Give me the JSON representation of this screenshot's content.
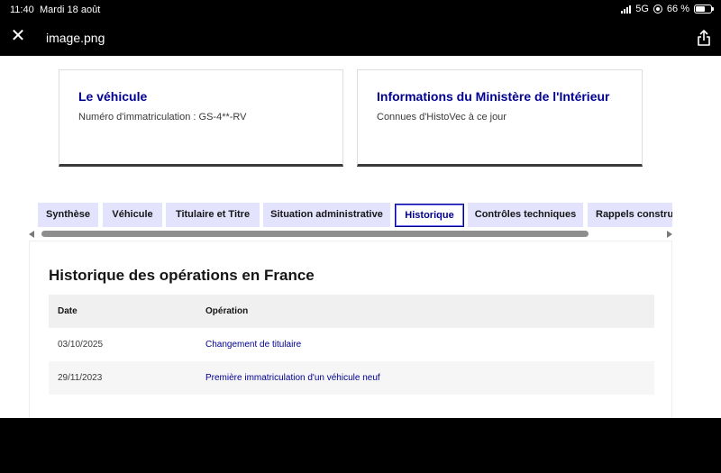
{
  "status": {
    "time": "11:40",
    "date": "Mardi 18 août",
    "network": "5G",
    "battery": "66 %"
  },
  "topbar": {
    "filename": "image.png"
  },
  "cards": [
    {
      "title": "Le véhicule",
      "subtitle": "Numéro d'immatriculation : GS-4**-RV"
    },
    {
      "title": "Informations du Ministère de l'Intérieur",
      "subtitle": "Connues d'HistoVec à ce jour"
    }
  ],
  "tabs": [
    {
      "label": "Synthèse"
    },
    {
      "label": "Véhicule"
    },
    {
      "label": "Titulaire et Titre"
    },
    {
      "label": "Situation administrative"
    },
    {
      "label": "Historique",
      "active": true
    },
    {
      "label": "Contrôles techniques"
    },
    {
      "label": "Rappels construc"
    }
  ],
  "section": {
    "title": "Historique des opérations en France",
    "columns": [
      "Date",
      "Opération"
    ],
    "rows": [
      {
        "date": "03/10/2025",
        "operation": "Changement de titulaire"
      },
      {
        "date": "29/11/2023",
        "operation": "Première immatriculation d'un véhicule neuf"
      }
    ]
  },
  "colors": {
    "accent": "#000091",
    "tab_bg": "#e3e3fd",
    "page_bg": "#ffffff",
    "chrome_bg": "#000000"
  },
  "icons": {
    "close": "close-icon",
    "share": "share-icon"
  }
}
